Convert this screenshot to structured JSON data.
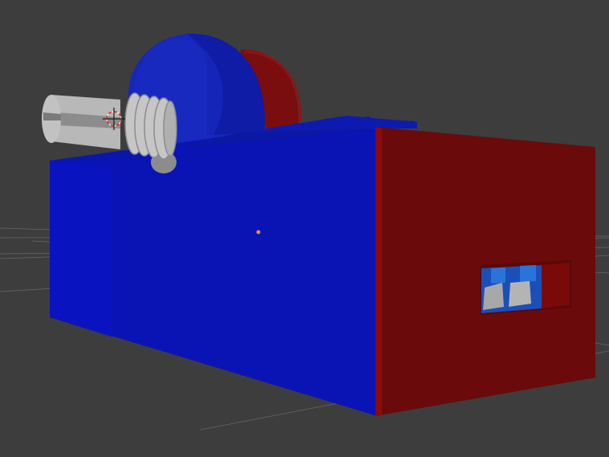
{
  "viewport": {
    "background": "#3d3d3d",
    "grid_color": "#8a8a8a",
    "horizon_color": "#9a9a9a"
  },
  "model": {
    "body_color": "#0a14b4",
    "body_top_color": "#0b18a3",
    "body_left_color": "#0a12c8",
    "end_panel_color": "#6a0a0a",
    "end_panel_edge_color": "#8a0b0b",
    "drum_front_color": "#1626b8",
    "drum_side_color": "#7a0d0d",
    "shaft_color": "#b8b8b8",
    "shaft_shadow_color": "#8c8c8c",
    "slot_inner_color": "#1a4fb8",
    "slot_highlight_color": "#2a73d9",
    "slot_block_color": "#a8a8a8"
  },
  "gizmos": {
    "cursor_name": "3d-cursor-icon",
    "origin_name": "object-origin-icon",
    "cursor_ring_color": "#d63a3a",
    "cursor_cross_color": "#1a1a1a",
    "origin_color": "#f08c3a"
  }
}
